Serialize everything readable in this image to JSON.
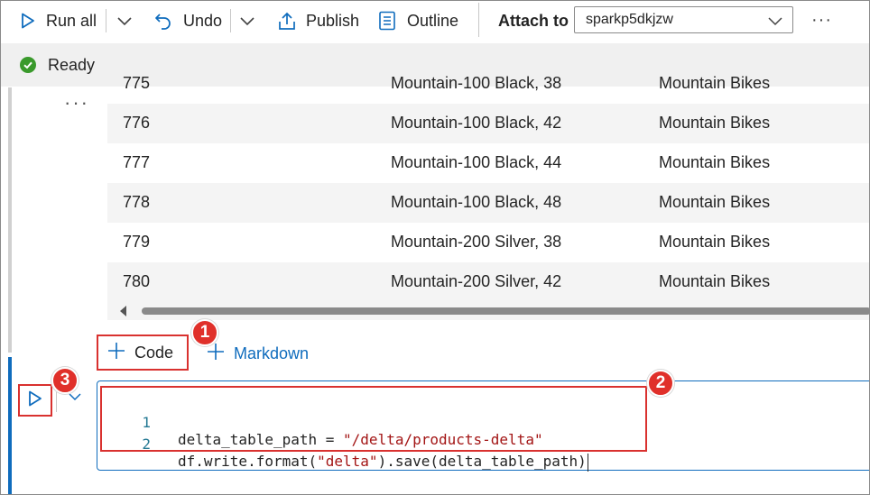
{
  "toolbar": {
    "run_all_label": "Run all",
    "undo_label": "Undo",
    "publish_label": "Publish",
    "outline_label": "Outline",
    "attach_to_label": "Attach to",
    "attach_to_value": "sparkp5dkjzw",
    "more_label": "···"
  },
  "status": {
    "text": "Ready",
    "color": "#3a9a2c"
  },
  "output": {
    "more_label": "···",
    "partial_row": [
      "775",
      "Mountain-100 Black, 38",
      "Mountain Bikes"
    ],
    "rows": [
      [
        "776",
        "Mountain-100 Black, 42",
        "Mountain Bikes"
      ],
      [
        "777",
        "Mountain-100 Black, 44",
        "Mountain Bikes"
      ],
      [
        "778",
        "Mountain-100 Black, 48",
        "Mountain Bikes"
      ],
      [
        "779",
        "Mountain-200 Silver, 38",
        "Mountain Bikes"
      ],
      [
        "780",
        "Mountain-200 Silver, 42",
        "Mountain Bikes"
      ]
    ]
  },
  "add_cell": {
    "code_label": "Code",
    "markdown_label": "Markdown"
  },
  "code_cell": {
    "lines": [
      {
        "number": "1",
        "code_before": "delta_table_path = ",
        "string": "\"/delta/products-delta\"",
        "code_after": ""
      },
      {
        "number": "2",
        "code_before": "df.write.format(",
        "string": "\"delta\"",
        "code_after": ").save(delta_table_path)"
      }
    ]
  },
  "callouts": [
    "1",
    "2",
    "3"
  ],
  "colors": {
    "accent": "#0f6cbd",
    "highlight": "#d9312f",
    "callout": "#e0302a",
    "string": "#a31515",
    "line_number": "#237893"
  }
}
